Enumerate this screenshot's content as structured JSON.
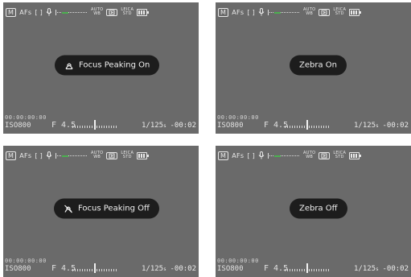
{
  "screens": [
    {
      "message": "Focus Peaking On",
      "message_icon": "focus-peaking-on-icon",
      "top": {
        "mode": "M",
        "af": "AFs",
        "af_area": "[ ]",
        "mic": "mic-icon",
        "wb_top": "AUTO",
        "wb_bottom": "WB",
        "stab": "stabilization-icon",
        "profile_top": "LEICA",
        "profile_bottom": "STD",
        "battery": "battery-icon"
      },
      "bottom": {
        "exposure_counter": "00:00:00:00",
        "iso": "ISO800",
        "aperture": "F 4.5",
        "shutter": "1/125",
        "shutter_unit": "s",
        "counter": "-00:02"
      }
    },
    {
      "message": "Zebra On",
      "message_icon": "",
      "top": {
        "mode": "M",
        "af": "AFs",
        "af_area": "[ ]",
        "mic": "mic-icon",
        "wb_top": "AUTO",
        "wb_bottom": "WB",
        "stab": "stabilization-icon",
        "profile_top": "LEICA",
        "profile_bottom": "STD",
        "battery": "battery-icon"
      },
      "bottom": {
        "exposure_counter": "00:00:00:00",
        "iso": "ISO800",
        "aperture": "F 4.5",
        "shutter": "1/125",
        "shutter_unit": "s",
        "counter": "-00:02"
      }
    },
    {
      "message": "Focus Peaking Off",
      "message_icon": "focus-peaking-off-icon",
      "top": {
        "mode": "M",
        "af": "AFs",
        "af_area": "[ ]",
        "mic": "mic-icon",
        "wb_top": "AUTO",
        "wb_bottom": "WB",
        "stab": "stabilization-icon",
        "profile_top": "LEICA",
        "profile_bottom": "STD",
        "battery": "battery-icon"
      },
      "bottom": {
        "exposure_counter": "00:00:00:00",
        "iso": "ISO800",
        "aperture": "F 4.5",
        "shutter": "1/125",
        "shutter_unit": "s",
        "counter": "-00:02"
      }
    },
    {
      "message": "Zebra Off",
      "message_icon": "",
      "top": {
        "mode": "M",
        "af": "AFs",
        "af_area": "[ ]",
        "mic": "mic-icon",
        "wb_top": "AUTO",
        "wb_bottom": "WB",
        "stab": "stabilization-icon",
        "profile_top": "LEICA",
        "profile_bottom": "STD",
        "battery": "battery-icon"
      },
      "bottom": {
        "exposure_counter": "00:00:00:00",
        "iso": "ISO800",
        "aperture": "F 4.5",
        "shutter": "1/125",
        "shutter_unit": "s",
        "counter": "-00:02"
      }
    }
  ],
  "colors": {
    "screen_bg": "#6a6a6a",
    "toast_bg": "#1d1d1d",
    "toast_text": "#f0f0f0",
    "wb_level": "#4caf50"
  }
}
